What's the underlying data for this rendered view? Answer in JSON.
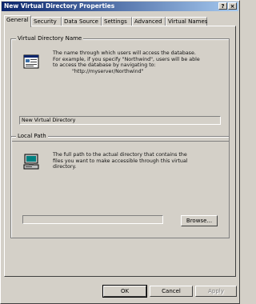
{
  "window": {
    "title": "New Virtual Directory Properties",
    "help_label": "?",
    "close_label": "×"
  },
  "tabs": [
    {
      "label": "General",
      "active": true
    },
    {
      "label": "Security",
      "active": false
    },
    {
      "label": "Data Source",
      "active": false
    },
    {
      "label": "Settings",
      "active": false
    },
    {
      "label": "Advanced",
      "active": false
    },
    {
      "label": "Virtual Names",
      "active": false
    }
  ],
  "virtual_directory": {
    "label": "Virtual Directory Name",
    "desc_line1": "The name through which users will access the database.",
    "desc_line2": "For example, if you specify \"Northwind\", users will be able",
    "desc_line3": "to access the database by navigating to:",
    "desc_line4": "\"http://myserver/Northwind\"",
    "name_value": "New Virtual Directory",
    "icon": "virtual-directory-icon"
  },
  "local_path": {
    "label": "Local Path",
    "desc_line1": "The full path to the actual directory that contains the",
    "desc_line2": "files you want to make accessible through this virtual",
    "desc_line3": "directory.",
    "path_value": "",
    "browse_label": "Browse...",
    "icon": "computer-icon"
  },
  "buttons": {
    "ok": "OK",
    "cancel": "Cancel",
    "apply": "Apply"
  }
}
